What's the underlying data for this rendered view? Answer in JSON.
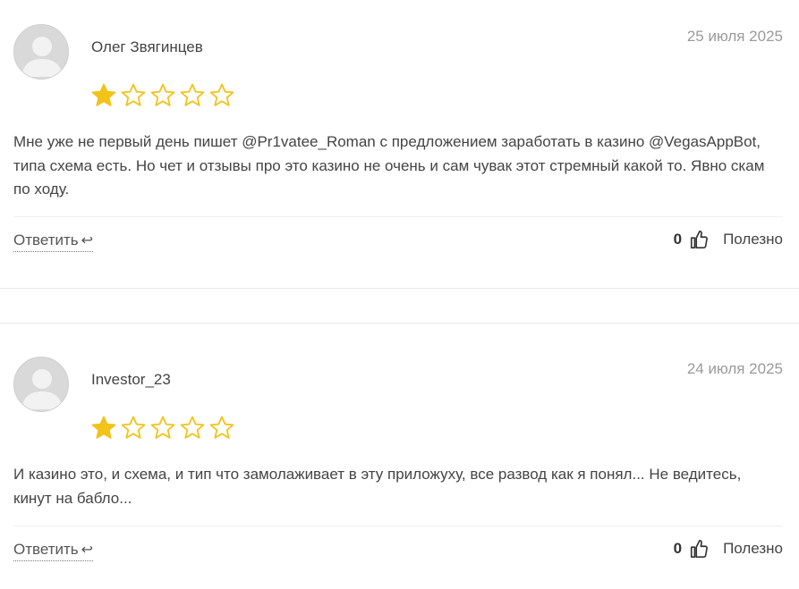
{
  "reviews": [
    {
      "author": "Олег Звягинцев",
      "date": "25 июля 2025",
      "rating": 1,
      "max_rating": 5,
      "text": "Мне уже не первый день пишет @Pr1vatee_Roman с предложением заработать в казино @VegasAppBot, типа схема есть. Но чет и отзывы про это казино не очень и сам чувак этот стремный какой то. Явно скам по ходу.",
      "reply_label": "Ответить",
      "reply_arrow": "↩",
      "helpful_count": "0",
      "helpful_label": "Полезно"
    },
    {
      "author": "Investor_23",
      "date": "24 июля 2025",
      "rating": 1,
      "max_rating": 5,
      "text": "И казино это, и схема, и тип что замолаживает в эту приложуху, все развод как я понял... Не ведитесь, кинут на бабло...",
      "reply_label": "Ответить",
      "reply_arrow": "↩",
      "helpful_count": "0",
      "helpful_label": "Полезно"
    }
  ],
  "colors": {
    "star_filled": "#f2c318",
    "star_outline": "#f2c318",
    "avatar_bg": "#d9d9d9",
    "avatar_fg": "#f2f2f2"
  },
  "icons": {
    "avatar": "user-avatar-icon",
    "star": "star-icon",
    "reply": "reply-arrow-icon",
    "like": "thumbs-up-icon"
  }
}
